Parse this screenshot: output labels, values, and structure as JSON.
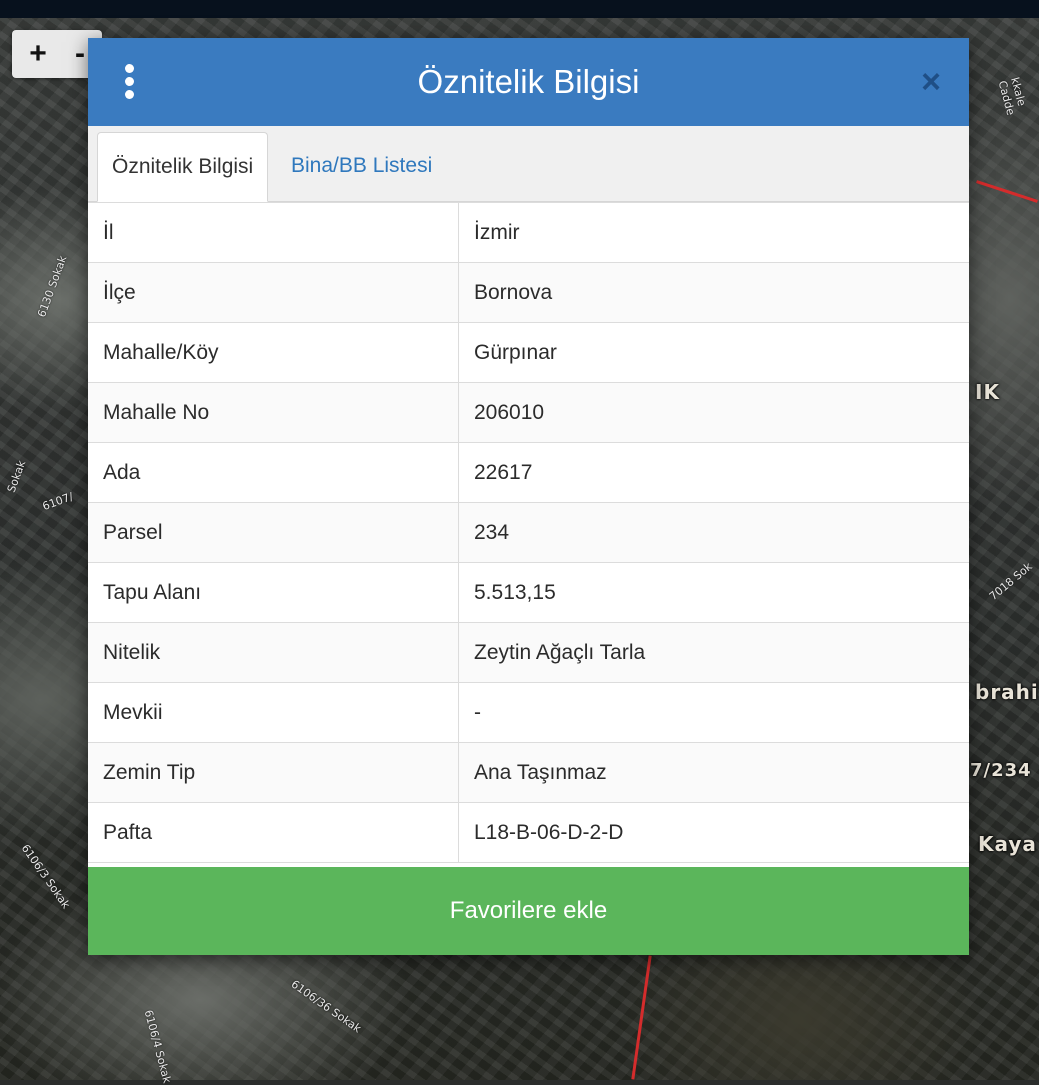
{
  "map": {
    "zoom_in_label": "+",
    "zoom_out_label": "-",
    "labels": [
      "IK",
      "brahi",
      "7/234",
      "Kaya"
    ],
    "streets": [
      "6130 Sokak",
      "6107/",
      "6106/3 Sokak",
      "6106/36 Sokak",
      "6106/4 Sokak",
      "kkale Cadde",
      "7018 Sok",
      "Sokak"
    ]
  },
  "modal": {
    "title": "Öznitelik Bilgisi",
    "close_label": "×",
    "tabs": [
      {
        "label": "Öznitelik Bilgisi",
        "active": true
      },
      {
        "label": "Bina/BB Listesi",
        "active": false
      }
    ],
    "rows": [
      {
        "key": "İl",
        "value": "İzmir"
      },
      {
        "key": "İlçe",
        "value": "Bornova"
      },
      {
        "key": "Mahalle/Köy",
        "value": "Gürpınar"
      },
      {
        "key": "Mahalle No",
        "value": "206010"
      },
      {
        "key": "Ada",
        "value": "22617"
      },
      {
        "key": "Parsel",
        "value": "234"
      },
      {
        "key": "Tapu Alanı",
        "value": "5.513,15"
      },
      {
        "key": "Nitelik",
        "value": "Zeytin Ağaçlı Tarla"
      },
      {
        "key": "Mevkii",
        "value": "-"
      },
      {
        "key": "Zemin Tip",
        "value": "Ana Taşınmaz"
      },
      {
        "key": "Pafta",
        "value": "L18-B-06-D-2-D"
      }
    ],
    "favorite_button": "Favorilere ekle"
  },
  "colors": {
    "header": "#3a7bc0",
    "tab_link": "#2f78bd",
    "favorite_button": "#5bb65b",
    "close_icon": "#1f4f86"
  }
}
